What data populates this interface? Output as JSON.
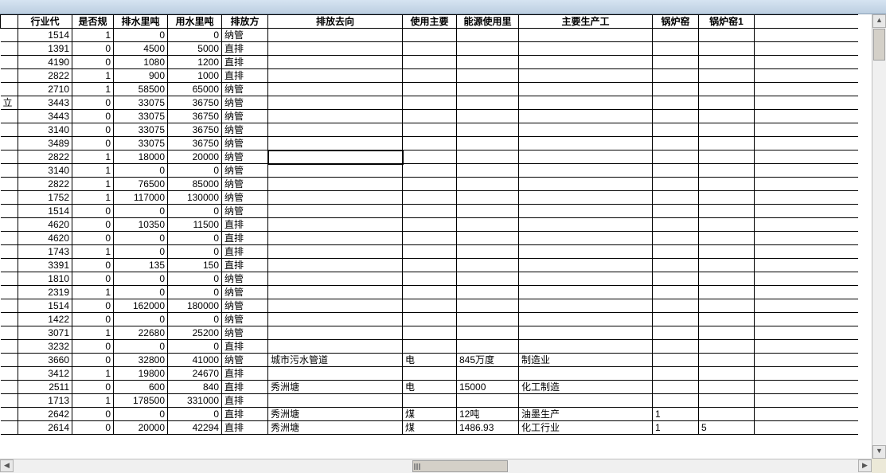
{
  "headers": {
    "stub": "",
    "a": "行业代",
    "b": "是否规",
    "c": "排水里吨",
    "d": "用水里吨",
    "e": "排放方",
    "f": "排放去向",
    "g": "使用主要",
    "h": "能源使用里",
    "i": "主要生产工",
    "j": "锅炉窑",
    "k": "锅炉窑1"
  },
  "rows": [
    {
      "a": "1514",
      "b": "1",
      "c": "0",
      "d": "0",
      "e": "纳管",
      "f": "",
      "g": "",
      "h": "",
      "i": "",
      "j": "",
      "k": ""
    },
    {
      "a": "1391",
      "b": "0",
      "c": "4500",
      "d": "5000",
      "e": "直排",
      "f": "",
      "g": "",
      "h": "",
      "i": "",
      "j": "",
      "k": ""
    },
    {
      "a": "4190",
      "b": "0",
      "c": "1080",
      "d": "1200",
      "e": "直排",
      "f": "",
      "g": "",
      "h": "",
      "i": "",
      "j": "",
      "k": ""
    },
    {
      "a": "2822",
      "b": "1",
      "c": "900",
      "d": "1000",
      "e": "直排",
      "f": "",
      "g": "",
      "h": "",
      "i": "",
      "j": "",
      "k": ""
    },
    {
      "a": "2710",
      "b": "1",
      "c": "58500",
      "d": "65000",
      "e": "纳管",
      "f": "",
      "g": "",
      "h": "",
      "i": "",
      "j": "",
      "k": ""
    },
    {
      "a": "3443",
      "b": "0",
      "c": "33075",
      "d": "36750",
      "e": "纳管",
      "f": "",
      "g": "",
      "h": "",
      "i": "",
      "j": "",
      "k": ""
    },
    {
      "a": "3443",
      "b": "0",
      "c": "33075",
      "d": "36750",
      "e": "纳管",
      "f": "",
      "g": "",
      "h": "",
      "i": "",
      "j": "",
      "k": ""
    },
    {
      "a": "3140",
      "b": "0",
      "c": "33075",
      "d": "36750",
      "e": "纳管",
      "f": "",
      "g": "",
      "h": "",
      "i": "",
      "j": "",
      "k": ""
    },
    {
      "a": "3489",
      "b": "0",
      "c": "33075",
      "d": "36750",
      "e": "纳管",
      "f": "",
      "g": "",
      "h": "",
      "i": "",
      "j": "",
      "k": ""
    },
    {
      "a": "2822",
      "b": "1",
      "c": "18000",
      "d": "20000",
      "e": "纳管",
      "f": "",
      "g": "",
      "h": "",
      "i": "",
      "j": "",
      "k": "",
      "sel": true
    },
    {
      "a": "3140",
      "b": "1",
      "c": "0",
      "d": "0",
      "e": "纳管",
      "f": "",
      "g": "",
      "h": "",
      "i": "",
      "j": "",
      "k": ""
    },
    {
      "a": "2822",
      "b": "1",
      "c": "76500",
      "d": "85000",
      "e": "纳管",
      "f": "",
      "g": "",
      "h": "",
      "i": "",
      "j": "",
      "k": ""
    },
    {
      "a": "1752",
      "b": "1",
      "c": "117000",
      "d": "130000",
      "e": "纳管",
      "f": "",
      "g": "",
      "h": "",
      "i": "",
      "j": "",
      "k": ""
    },
    {
      "a": "1514",
      "b": "0",
      "c": "0",
      "d": "0",
      "e": "纳管",
      "f": "",
      "g": "",
      "h": "",
      "i": "",
      "j": "",
      "k": ""
    },
    {
      "a": "4620",
      "b": "0",
      "c": "10350",
      "d": "11500",
      "e": "直排",
      "f": "",
      "g": "",
      "h": "",
      "i": "",
      "j": "",
      "k": ""
    },
    {
      "a": "4620",
      "b": "0",
      "c": "0",
      "d": "0",
      "e": "直排",
      "f": "",
      "g": "",
      "h": "",
      "i": "",
      "j": "",
      "k": ""
    },
    {
      "a": "1743",
      "b": "1",
      "c": "0",
      "d": "0",
      "e": "直排",
      "f": "",
      "g": "",
      "h": "",
      "i": "",
      "j": "",
      "k": ""
    },
    {
      "a": "3391",
      "b": "0",
      "c": "135",
      "d": "150",
      "e": "直排",
      "f": "",
      "g": "",
      "h": "",
      "i": "",
      "j": "",
      "k": ""
    },
    {
      "a": "1810",
      "b": "0",
      "c": "0",
      "d": "0",
      "e": "纳管",
      "f": "",
      "g": "",
      "h": "",
      "i": "",
      "j": "",
      "k": ""
    },
    {
      "a": "2319",
      "b": "1",
      "c": "0",
      "d": "0",
      "e": "纳管",
      "f": "",
      "g": "",
      "h": "",
      "i": "",
      "j": "",
      "k": ""
    },
    {
      "a": "1514",
      "b": "0",
      "c": "162000",
      "d": "180000",
      "e": "纳管",
      "f": "",
      "g": "",
      "h": "",
      "i": "",
      "j": "",
      "k": ""
    },
    {
      "a": "1422",
      "b": "0",
      "c": "0",
      "d": "0",
      "e": "纳管",
      "f": "",
      "g": "",
      "h": "",
      "i": "",
      "j": "",
      "k": ""
    },
    {
      "a": "3071",
      "b": "1",
      "c": "22680",
      "d": "25200",
      "e": "纳管",
      "f": "",
      "g": "",
      "h": "",
      "i": "",
      "j": "",
      "k": ""
    },
    {
      "a": "3232",
      "b": "0",
      "c": "0",
      "d": "0",
      "e": "直排",
      "f": "",
      "g": "",
      "h": "",
      "i": "",
      "j": "",
      "k": ""
    },
    {
      "a": "3660",
      "b": "0",
      "c": "32800",
      "d": "41000",
      "e": "纳管",
      "f": "城市污水管道",
      "g": "电",
      "h": "845万度",
      "i": "制造业",
      "j": "",
      "k": ""
    },
    {
      "a": "3412",
      "b": "1",
      "c": "19800",
      "d": "24670",
      "e": "直排",
      "f": "",
      "g": "",
      "h": "",
      "i": "",
      "j": "",
      "k": ""
    },
    {
      "a": "2511",
      "b": "0",
      "c": "600",
      "d": "840",
      "e": "直排",
      "f": "秀洲塘",
      "g": "电",
      "h": "15000",
      "i": "化工制造",
      "j": "",
      "k": ""
    },
    {
      "a": "1713",
      "b": "1",
      "c": "178500",
      "d": "331000",
      "e": "直排",
      "f": "",
      "g": "",
      "h": "",
      "i": "",
      "j": "",
      "k": ""
    },
    {
      "a": "2642",
      "b": "0",
      "c": "0",
      "d": "0",
      "e": "直排",
      "f": "秀洲塘",
      "g": "煤",
      "h": "12吨",
      "i": "油墨生产",
      "j": "1",
      "k": ""
    },
    {
      "a": "2614",
      "b": "0",
      "c": "20000",
      "d": "42294",
      "e": "直排",
      "f": "秀洲塘",
      "g": "煤",
      "h": "1486.93",
      "i": "化工行业",
      "j": "1",
      "k": "5"
    }
  ],
  "row6_stub": "立"
}
